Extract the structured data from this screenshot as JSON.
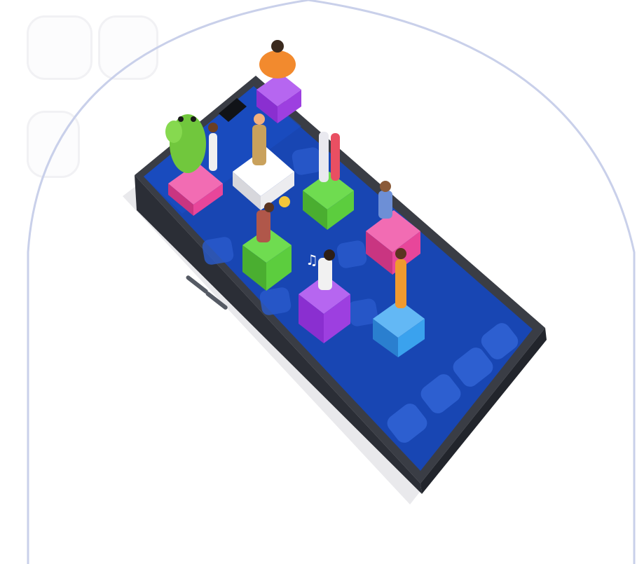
{
  "image": {
    "subject": "",
    "accent_colors": {
      "frame_outline": "#c9d0ea",
      "screen_blue": "#1846b3",
      "screen_dark": "#0e2f86",
      "phone_body": "#2b2e36",
      "platform_pink": "#e8469a",
      "platform_white": "#f2f2f2",
      "platform_purple": "#9d3fe0",
      "platform_green": "#5ccd3e",
      "platform_blue": "#3aa2ee",
      "platform_orange": "#f29a2e"
    }
  }
}
